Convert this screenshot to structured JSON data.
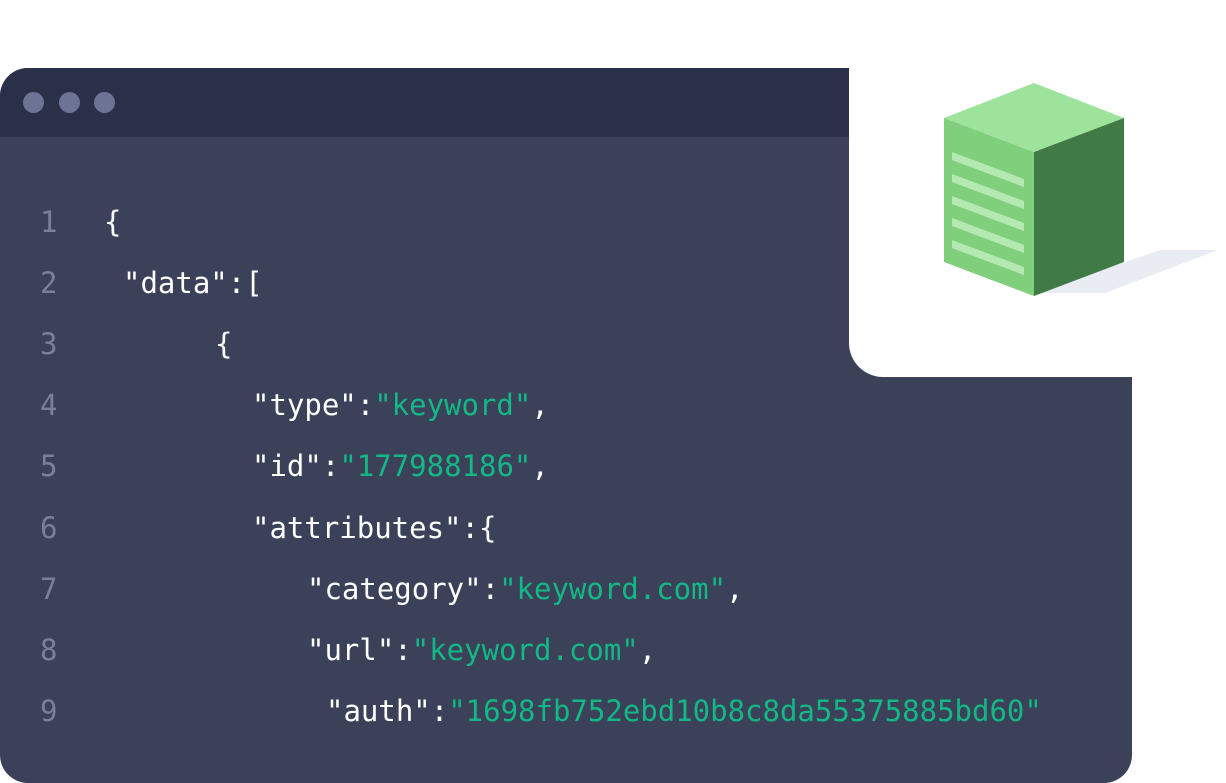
{
  "editor": {
    "lines": [
      {
        "num": "1",
        "parts": [
          {
            "t": "{",
            "c": "punc"
          }
        ]
      },
      {
        "num": "2",
        "parts": [
          {
            "t": "\"data\":[",
            "c": "punc"
          }
        ]
      },
      {
        "num": "3",
        "parts": [
          {
            "t": "{",
            "c": "punc"
          }
        ]
      },
      {
        "num": "4",
        "parts": [
          {
            "t": "\"type\":",
            "c": "punc"
          },
          {
            "t": "\"keyword\"",
            "c": "str"
          },
          {
            "t": ",",
            "c": "punc"
          }
        ]
      },
      {
        "num": "5",
        "parts": [
          {
            "t": "\"id\":",
            "c": "punc"
          },
          {
            "t": "\"177988186\"",
            "c": "str"
          },
          {
            "t": ",",
            "c": "punc"
          }
        ]
      },
      {
        "num": "6",
        "parts": [
          {
            "t": "\"attributes\":{",
            "c": "punc"
          }
        ]
      },
      {
        "num": "7",
        "parts": [
          {
            "t": "\"category\":",
            "c": "punc"
          },
          {
            "t": "\"keyword.com\"",
            "c": "str"
          },
          {
            "t": ",",
            "c": "punc"
          }
        ]
      },
      {
        "num": "8",
        "parts": [
          {
            "t": "\"url\":",
            "c": "punc"
          },
          {
            "t": "\"keyword.com\"",
            "c": "str"
          },
          {
            "t": ",",
            "c": "punc"
          }
        ]
      },
      {
        "num": "9",
        "parts": [
          {
            "t": "\"auth\":",
            "c": "punc"
          },
          {
            "t": "\"1698fb752ebd10b8c8da55375885bd60\"",
            "c": "str"
          }
        ]
      }
    ]
  },
  "colors": {
    "window_bg": "#3a4158",
    "title_bar": "#2b3049",
    "string": "#12b886",
    "line_number": "#7a809a",
    "cube_top": "#9ee39c",
    "cube_left": "#7fcf7d",
    "cube_right": "#407a44"
  },
  "icons": {
    "window_controls": [
      "window-dot-icon",
      "window-dot-icon",
      "window-dot-icon"
    ],
    "illustration": "green-document-cube-icon"
  }
}
